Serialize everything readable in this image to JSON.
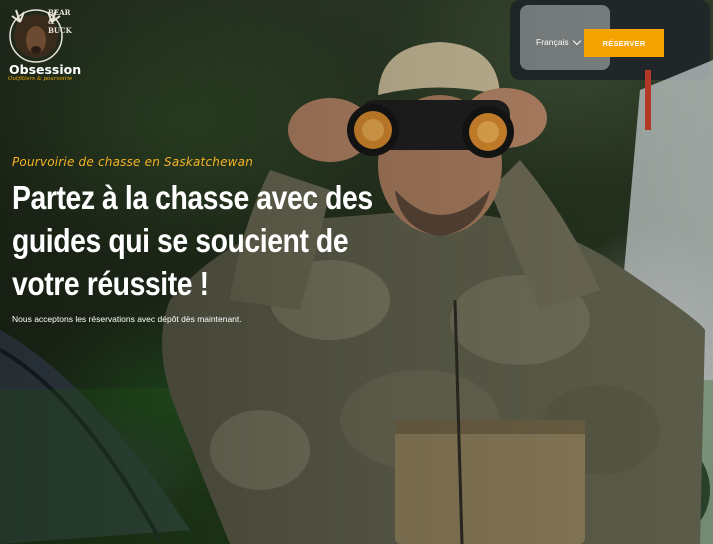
{
  "logo": {
    "arc_text": "BEAR & BUCK",
    "wordmark": "Obsession",
    "tagline": "Outfitters & pourvoirie"
  },
  "nav": {
    "language": "Français",
    "reserve_button": "RÉSERVER"
  },
  "hero": {
    "eyebrow": "Pourvoirie de chasse en Saskatchewan",
    "headline": "Partez à la chasse avec des guides qui se soucient de votre réussite !",
    "subtext": "Nous acceptons les réservations avec dépôt dès maintenant."
  },
  "colors": {
    "accent": "#f5a300",
    "eyebrow": "#f5b324",
    "text": "#ffffff"
  }
}
